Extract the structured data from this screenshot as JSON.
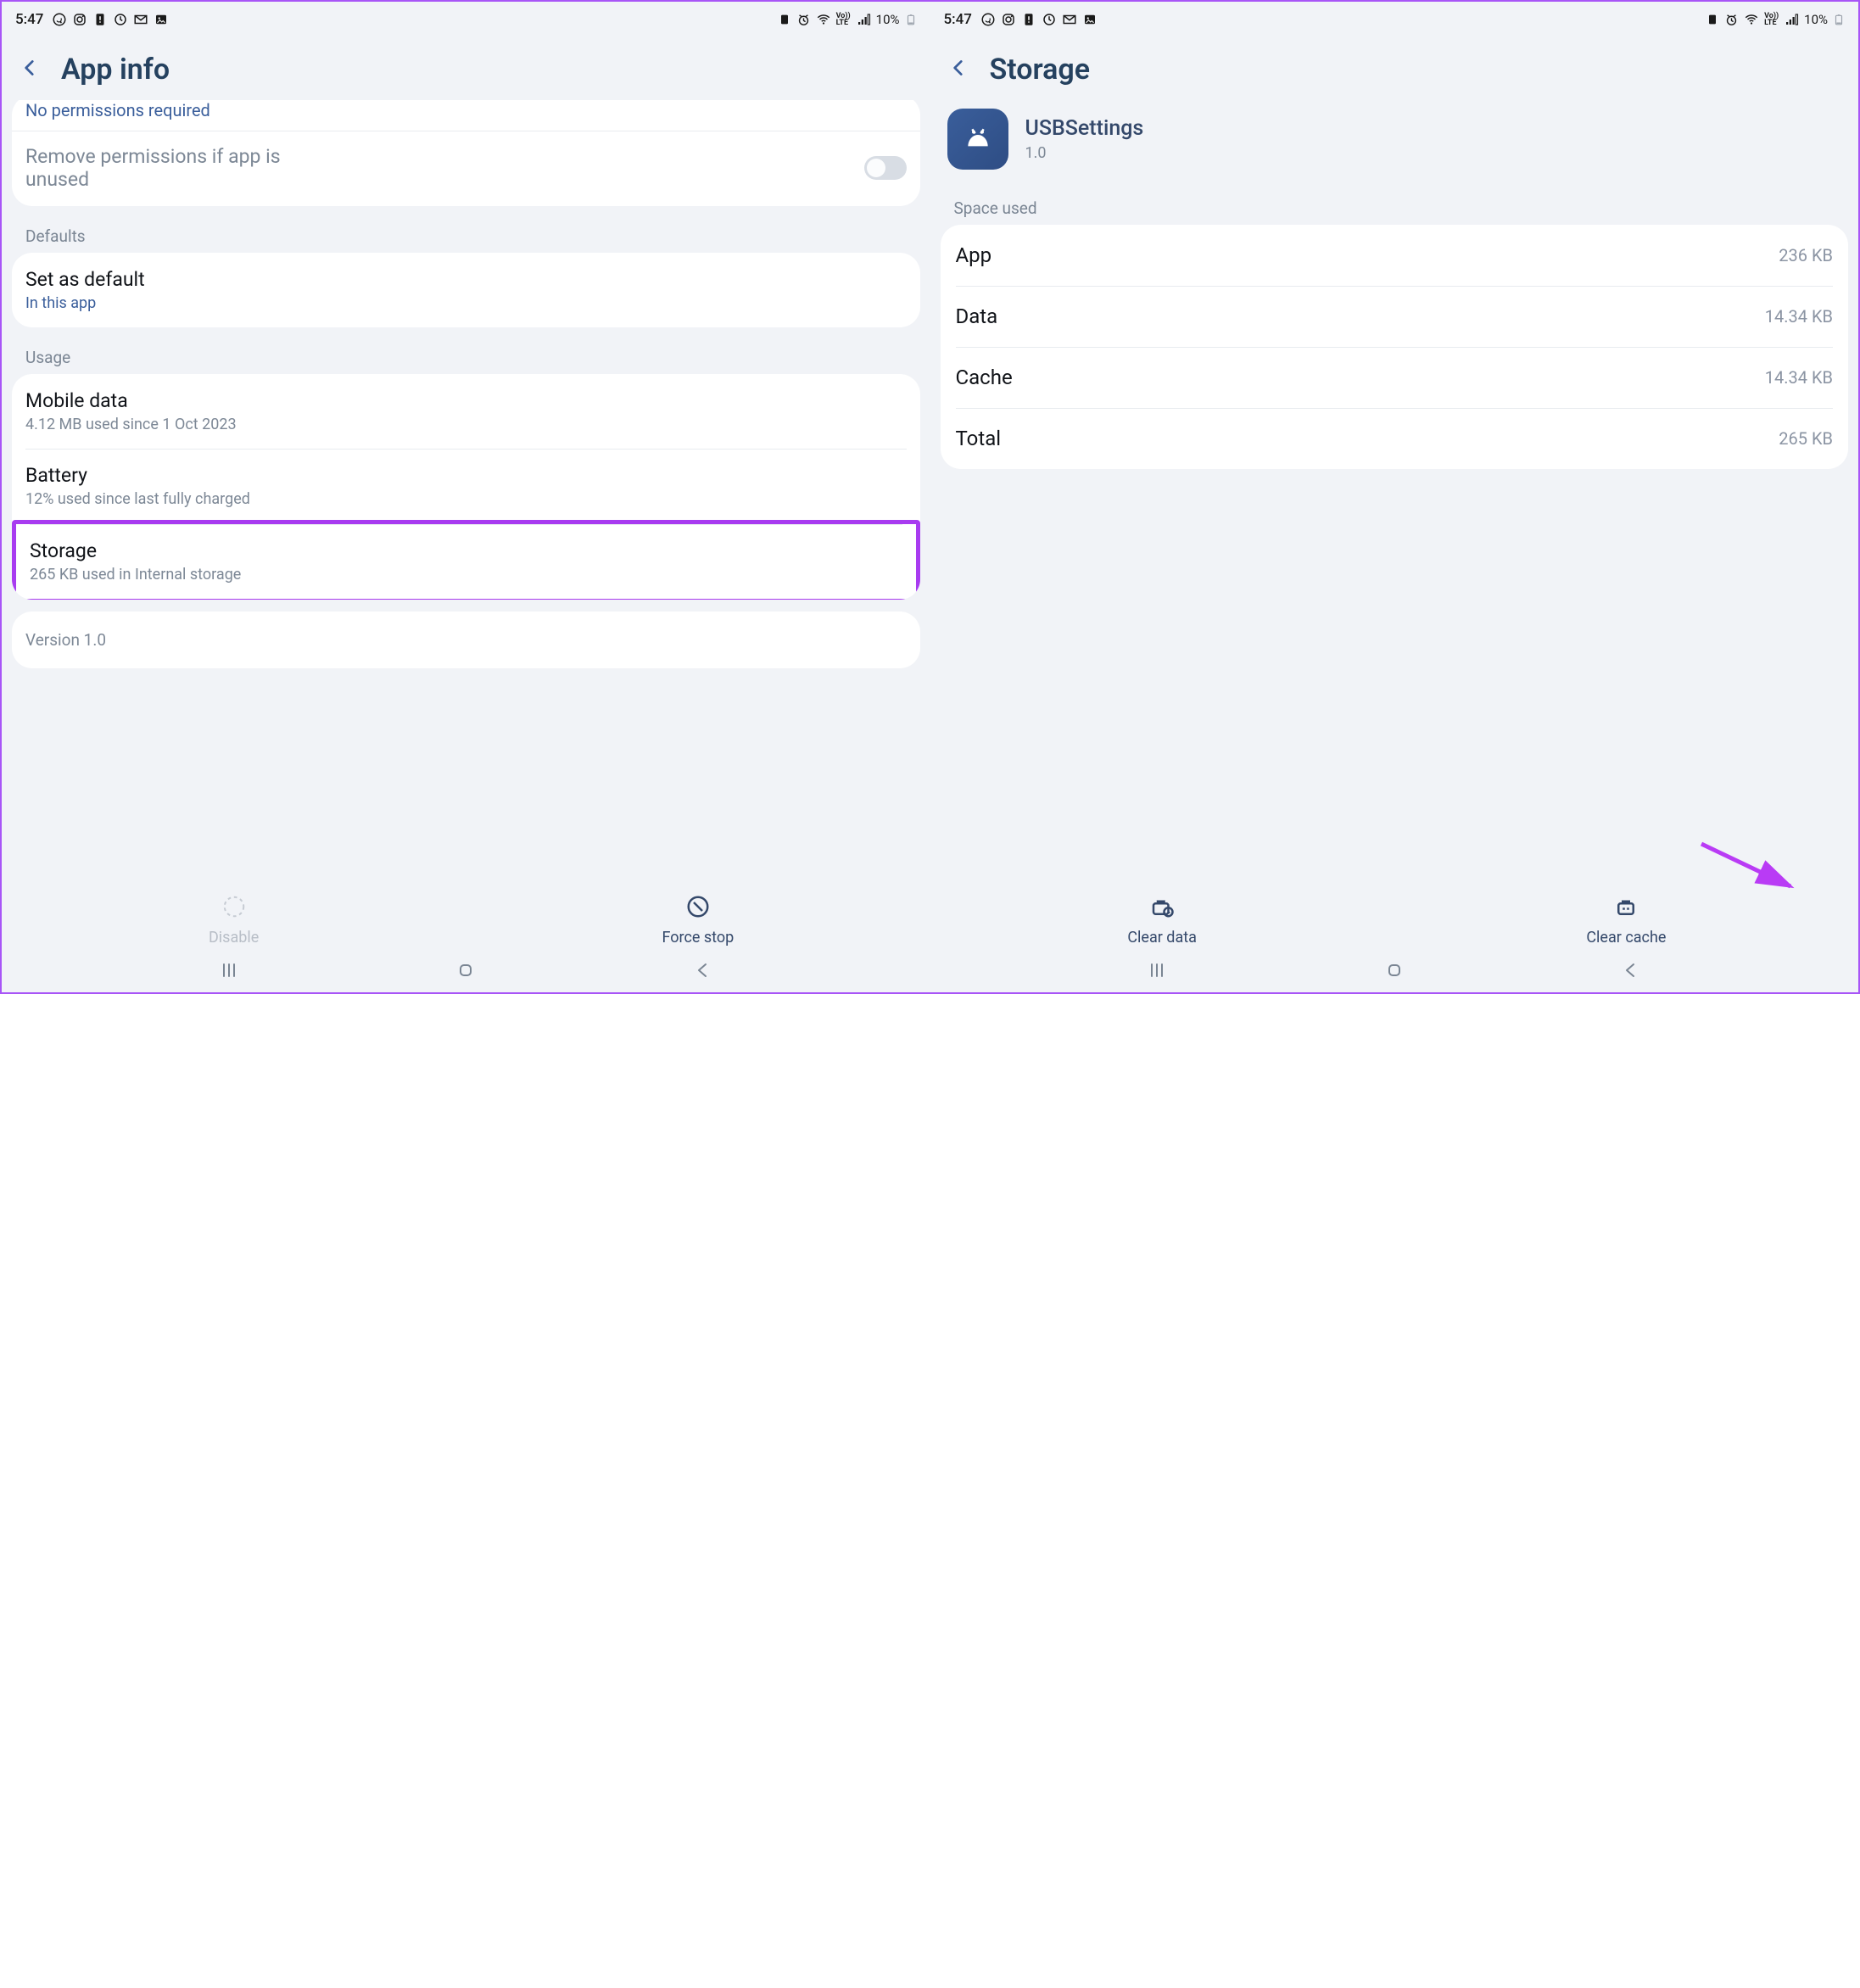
{
  "status": {
    "time": "5:47",
    "battery_pct": "10%"
  },
  "left": {
    "title": "App info",
    "partial_top_text": "No permissions required",
    "remove_perm_label": "Remove permissions if app is unused",
    "section_defaults": "Defaults",
    "set_default_title": "Set as default",
    "set_default_sub": "In this app",
    "section_usage": "Usage",
    "mobile_data_title": "Mobile data",
    "mobile_data_sub": "4.12 MB used since 1 Oct 2023",
    "battery_title": "Battery",
    "battery_sub": "12% used since last fully charged",
    "storage_title": "Storage",
    "storage_sub": "265 KB used in Internal storage",
    "version_label": "Version 1.0",
    "disable_label": "Disable",
    "force_stop_label": "Force stop"
  },
  "right": {
    "title": "Storage",
    "app_name": "USBSettings",
    "app_version": "1.0",
    "section_space_used": "Space used",
    "rows": {
      "app_key": "App",
      "app_val": "236 KB",
      "data_key": "Data",
      "data_val": "14.34 KB",
      "cache_key": "Cache",
      "cache_val": "14.34 KB",
      "total_key": "Total",
      "total_val": "265 KB"
    },
    "clear_data_label": "Clear data",
    "clear_cache_label": "Clear cache"
  }
}
